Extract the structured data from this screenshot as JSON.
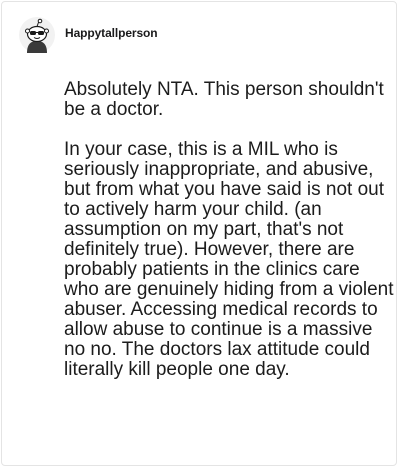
{
  "comment": {
    "username": "Happytallperson",
    "avatar_icon": "snoo-avatar-icon",
    "paragraphs": [
      "Absolutely NTA. This person shouldn't be a doctor.",
      "In your case, this is a MIL who is seriously inappropriate, and abusive, but from what you have said is not out to actively harm your child. (an assumption on my part, that's not definitely true). However, there are probably patients in the clinics care who are genuinely hiding from a violent abuser. Accessing medical records to allow abuse to continue is a massive no no. The doctors lax attitude could literally kill people one day."
    ]
  },
  "colors": {
    "text": "#1c1c1c",
    "border": "#e4e4e4",
    "avatar_bg": "#f2f2f2"
  }
}
